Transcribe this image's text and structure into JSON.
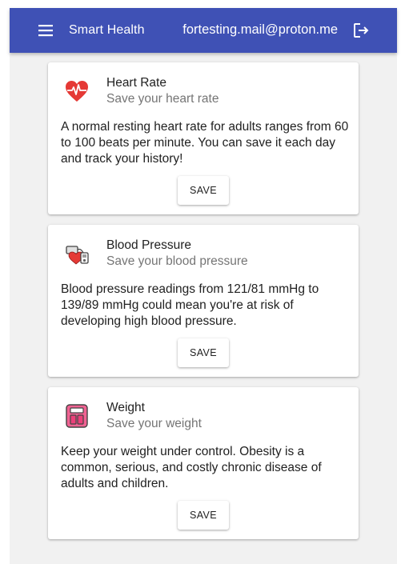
{
  "appbar": {
    "title": "Smart Health",
    "user_email": "fortesting.mail@proton.me",
    "menu_icon": "menu-icon",
    "logout_icon": "logout-icon",
    "color": "#3f51b5"
  },
  "cards": [
    {
      "title": "Heart Rate",
      "subtitle": "Save your heart rate",
      "text": "A normal resting heart rate for adults ranges from 60 to 100 beats per minute. You can save it each day and track your history!",
      "button": "SAVE",
      "icon": "heart-rate-icon"
    },
    {
      "title": "Blood Pressure",
      "subtitle": "Save your blood pressure",
      "text": "Blood pressure readings from 121/81 mmHg to 139/89 mmHg could mean you're at risk of developing high blood pressure.",
      "button": "SAVE",
      "icon": "blood-pressure-icon"
    },
    {
      "title": "Weight",
      "subtitle": "Save your weight",
      "text": "Keep your weight under control. Obesity is a common, serious, and costly chronic disease of adults and children.",
      "button": "SAVE",
      "icon": "weight-scale-icon"
    }
  ]
}
